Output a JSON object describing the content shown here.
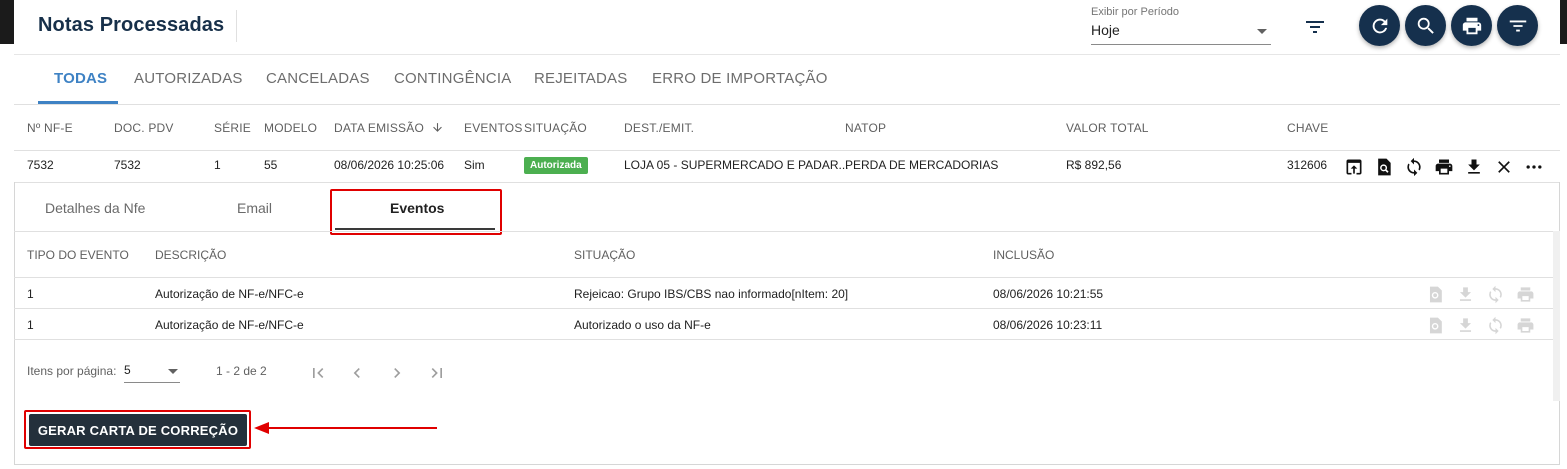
{
  "page_title": "Notas Processadas",
  "period": {
    "label": "Exibir por Período",
    "value": "Hoje"
  },
  "header_icons": [
    "filter-icon",
    "refresh-icon",
    "search-icon",
    "print-icon",
    "filter-icon"
  ],
  "status_tabs": [
    "TODAS",
    "AUTORIZADAS",
    "CANCELADAS",
    "CONTINGÊNCIA",
    "REJEITADAS",
    "ERRO DE IMPORTAÇÃO"
  ],
  "notes_table": {
    "columns": [
      "Nº NF-E",
      "DOC. PDV",
      "SÉRIE",
      "MODELO",
      "DATA EMISSÃO",
      "EVENTOS",
      "SITUAÇÃO",
      "DEST./EMIT.",
      "NATOP",
      "VALOR TOTAL",
      "CHAVE"
    ],
    "sort_column": "DATA EMISSÃO",
    "sort_direction": "desc",
    "row": {
      "nf": "7532",
      "doc_pdv": "7532",
      "serie": "1",
      "modelo": "55",
      "data_emissao": "08/06/2026 10:25:06",
      "eventos": "Sim",
      "situacao": "Autorizada",
      "dest_emit": "LOJA 05 - SUPERMERCADO E PADAR...",
      "natop": "PERDA DE MERCADORIAS",
      "valor_total": "R$ 892,56",
      "chave": "312606"
    },
    "row_actions": [
      "upload-icon",
      "view-document-icon",
      "sync-icon",
      "print-icon",
      "download-icon",
      "close-icon",
      "more-icon"
    ],
    "status_color": "#4caf50"
  },
  "detail_tabs": [
    "Detalhes da Nfe",
    "Email",
    "Eventos"
  ],
  "detail_active_tab": "Eventos",
  "events_table": {
    "columns": [
      "TIPO DO EVENTO",
      "DESCRIÇÃO",
      "SITUAÇÃO",
      "INCLUSÃO"
    ],
    "rows": [
      {
        "tipo": "1",
        "descricao": "Autorização de NF-e/NFC-e",
        "situacao": "Rejeicao: Grupo IBS/CBS nao informado[nItem: 20]",
        "inclusao": "08/06/2026 10:21:55"
      },
      {
        "tipo": "1",
        "descricao": "Autorização de NF-e/NFC-e",
        "situacao": "Autorizado o uso da NF-e",
        "inclusao": "08/06/2026 10:23:11"
      }
    ],
    "row_actions": [
      "view-document-icon",
      "download-icon",
      "sync-icon",
      "print-icon"
    ]
  },
  "paginator": {
    "items_label": "Itens por página:",
    "page_size": "5",
    "range": "1 - 2 de 2"
  },
  "action_button": "GERAR CARTA DE CORREÇÃO",
  "colors": {
    "navy": "#15304d",
    "accent_blue": "#3e82c4",
    "highlight_red": "#e00000",
    "button_dark": "#24303b"
  }
}
